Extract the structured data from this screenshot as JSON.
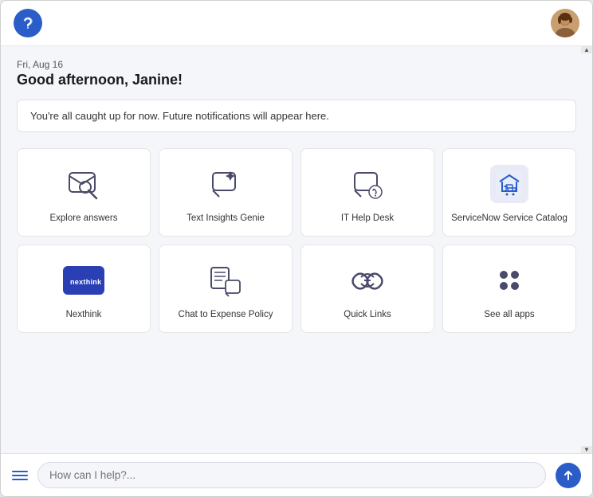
{
  "header": {
    "logo_alt": "App logo",
    "avatar_alt": "User avatar"
  },
  "greeting": {
    "date": "Fri, Aug 16",
    "message": "Good afternoon, Janine!"
  },
  "notification": {
    "text": "You're all caught up for now. Future notifications will appear here."
  },
  "apps": [
    {
      "id": "explore-answers",
      "label": "Explore answers",
      "icon_type": "chat-search"
    },
    {
      "id": "text-insights-genie",
      "label": "Text Insights Genie",
      "icon_type": "sparkle-chat"
    },
    {
      "id": "it-help-desk",
      "label": "IT Help Desk",
      "icon_type": "headset-chat"
    },
    {
      "id": "servicenow-service-catalog",
      "label": "ServiceNow Service Catalog",
      "icon_type": "cart"
    },
    {
      "id": "nexthink",
      "label": "Nexthink",
      "icon_type": "nexthink-logo"
    },
    {
      "id": "chat-expense-policy",
      "label": "Chat to Expense Policy",
      "icon_type": "chat-doc"
    },
    {
      "id": "quick-links",
      "label": "Quick Links",
      "icon_type": "link"
    },
    {
      "id": "see-all-apps",
      "label": "See all apps",
      "icon_type": "dots-grid"
    }
  ],
  "bottom_bar": {
    "search_placeholder": "How can I help?...",
    "menu_icon": "menu",
    "send_icon": "send"
  }
}
